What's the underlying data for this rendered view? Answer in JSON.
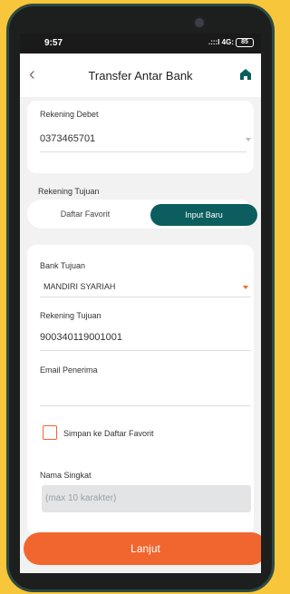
{
  "status": {
    "time": "9:57",
    "signal": ".:::l 4G: ",
    "battery": "85"
  },
  "header": {
    "title": "Transfer Antar Bank",
    "back_icon": "chevron-left-icon",
    "home_icon": "home-icon"
  },
  "debit": {
    "label": "Rekening Debet",
    "value": "0373465701"
  },
  "tujuan_section": {
    "label": "Rekening Tujuan"
  },
  "toggle": {
    "left_label": "Daftar Favorit",
    "right_label": "Input Baru",
    "selected": "Input Baru"
  },
  "form": {
    "bank_label": "Bank Tujuan",
    "bank_value": "MANDIRI SYARIAH",
    "account_label": "Rekening Tujuan",
    "account_value": "900340119001001",
    "email_label": "Email Penerima",
    "email_value": "",
    "save_fav_label": "Simpan ke Daftar Favorit",
    "short_name_label": "Nama Singkat",
    "short_name_placeholder": "(max 10 karakter)"
  },
  "submit": {
    "label": "Lanjut"
  },
  "colors": {
    "accent": "#f1662e",
    "brand": "#0c5e5e"
  }
}
